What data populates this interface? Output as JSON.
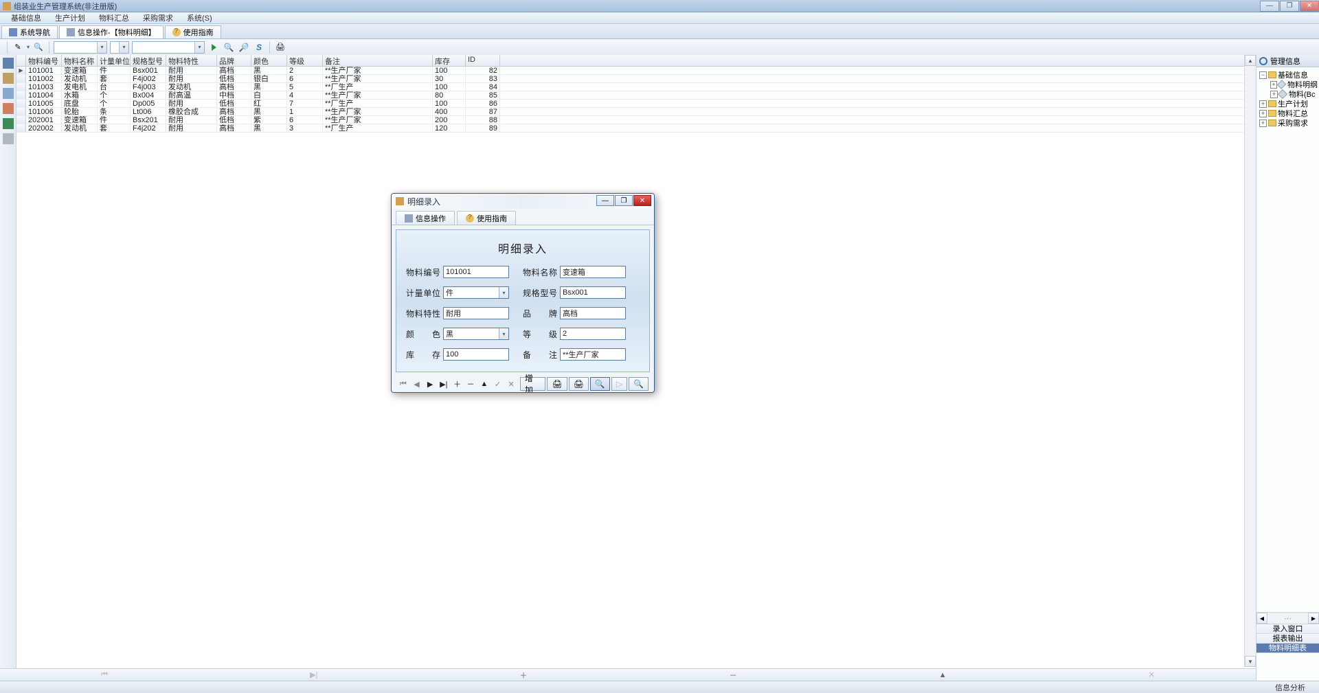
{
  "app": {
    "title": "组装业生产管理系统(非注册版)"
  },
  "menus": [
    "基础信息",
    "生产计划",
    "物料汇总",
    "采购需求",
    "系统(S)"
  ],
  "tabs": [
    {
      "label": "系统导航"
    },
    {
      "label": "信息操作-【物料明细】"
    },
    {
      "label": "使用指南"
    }
  ],
  "grid": {
    "columns": [
      "物料编号",
      "物料名称",
      "计量单位",
      "规格型号",
      "物料特性",
      "品牌",
      "颜色",
      "等级",
      "备注",
      "库存",
      "ID"
    ],
    "rows": [
      [
        "101001",
        "变速箱",
        "件",
        "Bsx001",
        "耐用",
        "高档",
        "黑",
        "2",
        "**生产厂家",
        "100",
        "82"
      ],
      [
        "101002",
        "发动机",
        "套",
        "F4j002",
        "耐用",
        "低档",
        "银白",
        "6",
        "**生产厂家",
        "30",
        "83"
      ],
      [
        "101003",
        "发电机",
        "台",
        "F4j003",
        "发动机",
        "高档",
        "黑",
        "5",
        "**厂生产",
        "100",
        "84"
      ],
      [
        "101004",
        "水箱",
        "个",
        "Bx004",
        "耐高温",
        "中档",
        "白",
        "4",
        "**生产厂家",
        "80",
        "85"
      ],
      [
        "101005",
        "底盘",
        "个",
        "Dp005",
        "耐用",
        "低档",
        "红",
        "7",
        "**厂生产",
        "100",
        "86"
      ],
      [
        "101006",
        "轮胎",
        "条",
        "Lt006",
        "橡胶合成",
        "高档",
        "黑",
        "1",
        "**生产厂家",
        "400",
        "87"
      ],
      [
        "202001",
        "变速箱",
        "件",
        "Bsx201",
        "耐用",
        "低档",
        "紫",
        "6",
        "**生产厂家",
        "200",
        "88"
      ],
      [
        "202002",
        "发动机",
        "套",
        "F4j202",
        "耐用",
        "高档",
        "黑",
        "3",
        "**厂生产",
        "120",
        "89"
      ]
    ]
  },
  "tree": {
    "title": "管理信息",
    "nodes": [
      {
        "label": "基础信息",
        "children": [
          "物料明纲",
          "物料(Bc"
        ]
      },
      {
        "label": "生产计划"
      },
      {
        "label": "物料汇总"
      },
      {
        "label": "采购需求"
      }
    ]
  },
  "right_bottom": {
    "items": [
      "录入窗口",
      "报表输出"
    ],
    "selected_extra": "物料明细表"
  },
  "dialog": {
    "title": "明细录入",
    "tabs": [
      "信息操作",
      "使用指南"
    ],
    "heading": "明细录入",
    "fields": {
      "material_no": {
        "label": "物料编号",
        "value": "101001"
      },
      "material_name": {
        "label": "物料名称",
        "value": "变速箱"
      },
      "unit": {
        "label": "计量单位",
        "value": "件"
      },
      "spec": {
        "label": "规格型号",
        "value": "Bsx001"
      },
      "feature": {
        "label": "物料特性",
        "value": "耐用"
      },
      "brand": {
        "label": "品 牌",
        "value": "高档"
      },
      "color": {
        "label": "颜 色",
        "value": "黑"
      },
      "grade": {
        "label": "等 级",
        "value": "2"
      },
      "stock": {
        "label": "库 存",
        "value": "100"
      },
      "remark": {
        "label": "备 注",
        "value": "**生产厂家"
      }
    },
    "add_button": "增加"
  },
  "status": {
    "right": "信息分析"
  }
}
